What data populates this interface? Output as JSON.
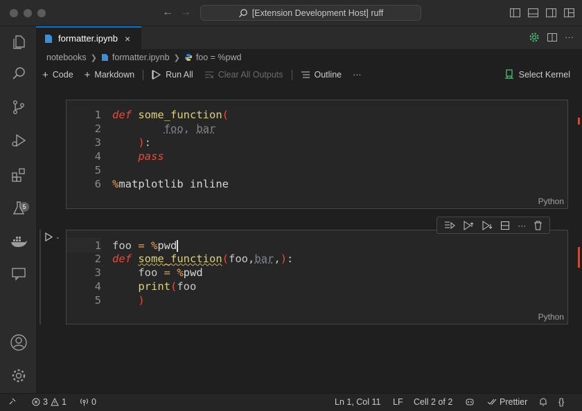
{
  "window": {
    "title": "[Extension Development Host] ruff"
  },
  "tab": {
    "label": "formatter.ipynb",
    "close": "×"
  },
  "breadcrumb": {
    "folder": "notebooks",
    "file": "formatter.ipynb",
    "cell": "foo = %pwd"
  },
  "toolbar": {
    "code": "Code",
    "markdown": "Markdown",
    "run_all": "Run All",
    "clear_outputs": "Clear All Outputs",
    "outline": "Outline",
    "more": "···",
    "select_kernel": "Select Kernel"
  },
  "activity": {
    "extensions_badge": "5"
  },
  "cell1": {
    "language": "Python",
    "lines": [
      {
        "n": "1",
        "tokens": [
          {
            "c": "kw",
            "t": "def"
          },
          {
            "c": "id",
            "t": " "
          },
          {
            "c": "fn",
            "t": "some_function"
          },
          {
            "c": "pc",
            "t": "("
          }
        ]
      },
      {
        "n": "2",
        "tokens": [
          {
            "c": "id",
            "t": "        "
          },
          {
            "c": "dim dot",
            "t": "foo"
          },
          {
            "c": "dim",
            "t": ", "
          },
          {
            "c": "dim dot",
            "t": "bar"
          }
        ]
      },
      {
        "n": "3",
        "tokens": [
          {
            "c": "id",
            "t": "    "
          },
          {
            "c": "pc",
            "t": ")"
          },
          {
            "c": "id",
            "t": ":"
          }
        ]
      },
      {
        "n": "4",
        "tokens": [
          {
            "c": "id",
            "t": "    "
          },
          {
            "c": "kw",
            "t": "pass"
          }
        ]
      },
      {
        "n": "5",
        "tokens": []
      },
      {
        "n": "6",
        "tokens": [
          {
            "c": "op",
            "t": "%"
          },
          {
            "c": "str",
            "t": "matplotlib inline"
          }
        ]
      }
    ]
  },
  "cell2": {
    "language": "Python",
    "lines": [
      {
        "n": "1",
        "current": true,
        "tokens": [
          {
            "c": "id",
            "t": "foo"
          },
          {
            "c": "op",
            "t": " = "
          },
          {
            "c": "op",
            "t": "%"
          },
          {
            "c": "str",
            "t": "pwd"
          },
          {
            "c": "cursor",
            "t": ""
          }
        ]
      },
      {
        "n": "2",
        "tokens": [
          {
            "c": "kw",
            "t": "def"
          },
          {
            "c": "id",
            "t": " "
          },
          {
            "c": "fn sq",
            "t": "some_function"
          },
          {
            "c": "pc",
            "t": "("
          },
          {
            "c": "id",
            "t": "foo,"
          },
          {
            "c": "dim dot",
            "t": "bar"
          },
          {
            "c": "id",
            "t": ","
          },
          {
            "c": "pc",
            "t": ")"
          },
          {
            "c": "id",
            "t": ":"
          }
        ]
      },
      {
        "n": "3",
        "tokens": [
          {
            "c": "id",
            "t": "    foo"
          },
          {
            "c": "op",
            "t": " = "
          },
          {
            "c": "op",
            "t": "%"
          },
          {
            "c": "str",
            "t": "pwd"
          }
        ]
      },
      {
        "n": "4",
        "tokens": [
          {
            "c": "id",
            "t": "    "
          },
          {
            "c": "fn",
            "t": "print"
          },
          {
            "c": "pc",
            "t": "("
          },
          {
            "c": "id",
            "t": "foo"
          }
        ]
      },
      {
        "n": "5",
        "tokens": [
          {
            "c": "id",
            "t": "    "
          },
          {
            "c": "pc",
            "t": ")"
          }
        ]
      }
    ]
  },
  "status": {
    "errors": "3",
    "warnings": "1",
    "ports": "0",
    "position": "Ln 1, Col 11",
    "eol": "LF",
    "cell": "Cell 2 of 2",
    "formatter": "Prettier",
    "braces": "{}"
  },
  "colors": {
    "accent": "#0078d4",
    "keyword": "#e84b3c",
    "function": "#dcd278",
    "magic": "#e8a25a"
  }
}
